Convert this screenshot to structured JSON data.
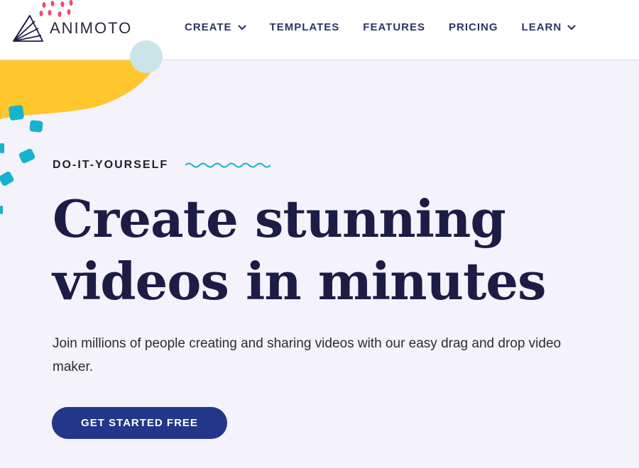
{
  "brand": {
    "name": "ANIMOTO",
    "icon": "animoto-fan-logo"
  },
  "nav": {
    "items": [
      {
        "label": "CREATE",
        "dropdown": true
      },
      {
        "label": "TEMPLATES",
        "dropdown": false
      },
      {
        "label": "FEATURES",
        "dropdown": false
      },
      {
        "label": "PRICING",
        "dropdown": false
      },
      {
        "label": "LEARN",
        "dropdown": true
      }
    ]
  },
  "hero": {
    "eyebrow": "DO-IT-YOURSELF",
    "headline_line1": "Create stunning",
    "headline_line2": "videos in minutes",
    "subtext": "Join millions of people creating and sharing videos with our easy drag and drop video maker.",
    "cta_label": "GET STARTED FREE"
  },
  "colors": {
    "background": "#f4f2fa",
    "header_bg": "#ffffff",
    "nav_text": "#2b3565",
    "headline": "#1c1c46",
    "cta_bg": "#23378a",
    "accent_yellow": "#ffc72c",
    "accent_teal": "#16b3cc",
    "accent_pink": "#ee4d6e"
  }
}
